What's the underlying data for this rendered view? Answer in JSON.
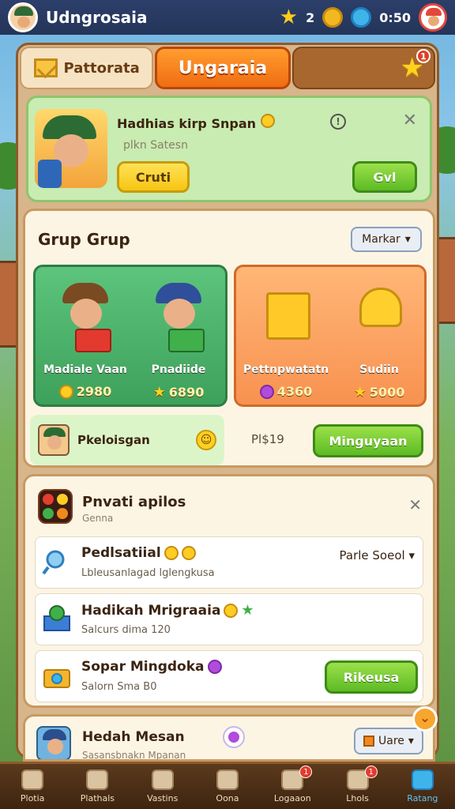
{
  "topbar": {
    "title": "Udngrosaia",
    "stars": "2",
    "timer": "0:50"
  },
  "tabs": [
    {
      "label": "Pattorata"
    },
    {
      "label": "Ungaraia"
    },
    {
      "label": ""
    }
  ],
  "tab_badge": "1",
  "quest": {
    "title": "Hadhias kirp Snpan",
    "subtitle": "plkn Satesn",
    "btn_left": "Cruti",
    "btn_right": "Gvl"
  },
  "group": {
    "title": "Grup Grup",
    "select": "Markar",
    "items": [
      {
        "name": "Madiale Vaan",
        "price": "2980"
      },
      {
        "name": "Pnadiide",
        "price": "6890"
      },
      {
        "name": "Pettnpwatatn",
        "price": "4360"
      },
      {
        "name": "Sudiin",
        "price": "5000"
      }
    ],
    "footer_label": "Pkeloisgan",
    "footer_count": "Pl$19",
    "footer_button": "Minguyaan"
  },
  "list": {
    "title": "Pnvati apilos",
    "subtitle": "Genna",
    "rows": [
      {
        "title": "Pedlsatiial",
        "sub": "Lbleusanlagad lglengkusa",
        "right": "Parle Soeol"
      },
      {
        "title": "Hadikah Mrigraaia",
        "sub": "Salcurs dima 120"
      },
      {
        "title": "Sopar Mingdoka",
        "sub": "Salorn Sma B0",
        "button": "Rikeusa"
      }
    ]
  },
  "partial": {
    "title": "Hedah Mesan",
    "sub": "Sasansbnakn Mpanan",
    "select": "Uare"
  },
  "nav": [
    {
      "label": "Plotia"
    },
    {
      "label": "Plathals"
    },
    {
      "label": "Vastins"
    },
    {
      "label": "Oona"
    },
    {
      "label": "Logaaon",
      "badge": "1"
    },
    {
      "label": "Lhols",
      "badge": "1"
    },
    {
      "label": "Ratang"
    }
  ],
  "colors": {
    "accent_orange": "#f06d12",
    "accent_green": "#5dbb24",
    "accent_blue": "#3fb4ea",
    "panel_border": "#8e5a2b"
  }
}
